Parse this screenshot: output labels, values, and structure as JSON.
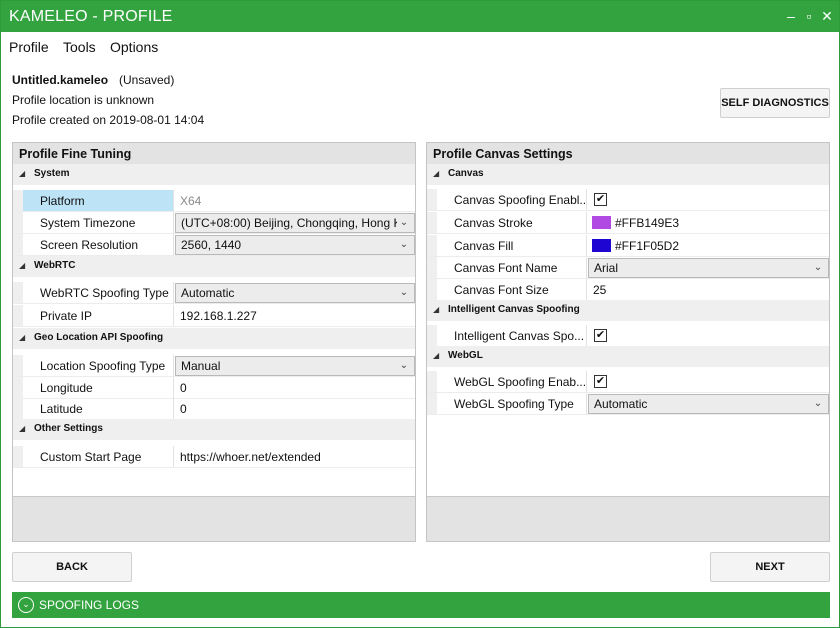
{
  "window": {
    "title": "KAMELEO - PROFILE",
    "minimize": "–",
    "maximize": "▫",
    "close": "✕"
  },
  "menu": {
    "items": [
      "Profile",
      "Tools",
      "Options"
    ]
  },
  "profile": {
    "name": "Untitled.kameleo",
    "status": "(Unsaved)",
    "location": "Profile location is unknown",
    "created": "Profile created on 2019-08-01 14:04"
  },
  "buttons": {
    "self_diagnostics": "SELF DIAGNOSTICS",
    "back": "BACK",
    "next": "NEXT"
  },
  "left_panel": {
    "title": "Profile Fine Tuning",
    "categories": {
      "system": "System",
      "webrtc": "WebRTC",
      "geo": "Geo Location API Spoofing",
      "other": "Other Settings"
    },
    "rows": {
      "platform": {
        "name": "Platform",
        "value": "X64"
      },
      "timezone": {
        "name": "System Timezone",
        "value": "(UTC+08:00) Beijing, Chongqing, Hong K"
      },
      "resolution": {
        "name": "Screen Resolution",
        "value": "2560, 1440"
      },
      "webrtc_type": {
        "name": "WebRTC Spoofing Type",
        "value": "Automatic"
      },
      "private_ip": {
        "name": "Private IP",
        "value": "192.168.1.227"
      },
      "location_type": {
        "name": "Location Spoofing Type",
        "value": "Manual"
      },
      "longitude": {
        "name": "Longitude",
        "value": "0"
      },
      "latitude": {
        "name": "Latitude",
        "value": "0"
      },
      "start_page": {
        "name": "Custom Start Page",
        "value": "https://whoer.net/extended"
      }
    }
  },
  "right_panel": {
    "title": "Profile Canvas Settings",
    "categories": {
      "canvas": "Canvas",
      "intelligent": "Intelligent Canvas Spoofing",
      "webgl": "WebGL"
    },
    "rows": {
      "canvas_spoofing": {
        "name": "Canvas Spoofing Enabl...",
        "checked": true
      },
      "stroke": {
        "name": "Canvas Stroke",
        "value": "#FFB149E3",
        "color": "#B149E3"
      },
      "fill": {
        "name": "Canvas Fill",
        "value": "#FF1F05D2",
        "color": "#1F05D2"
      },
      "font_name": {
        "name": "Canvas Font Name",
        "value": "Arial"
      },
      "font_size": {
        "name": "Canvas Font Size",
        "value": "25"
      },
      "intelligent": {
        "name": "Intelligent Canvas Spo...",
        "checked": true
      },
      "webgl_enabled": {
        "name": "WebGL Spoofing Enab...",
        "checked": true
      },
      "webgl_type": {
        "name": "WebGL Spoofing Type",
        "value": "Automatic"
      }
    }
  },
  "logs": {
    "label": "SPOOFING LOGS",
    "icon": "chevron-down-circle-icon"
  },
  "colors": {
    "accent": "#33A33F",
    "selection": "#BDE3F6"
  }
}
